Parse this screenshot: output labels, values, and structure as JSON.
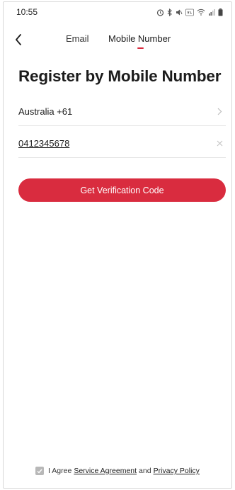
{
  "status_bar": {
    "time": "10:55"
  },
  "nav": {
    "back_icon": "chevron-left-icon",
    "tabs": [
      {
        "label": "Email"
      },
      {
        "label": "Mobile Number"
      }
    ],
    "active_tab": "Mobile Number"
  },
  "main": {
    "title": "Register by Mobile Number",
    "country_label": "Australia +61",
    "phone_value": "0412345678",
    "button_label": "Get Verification Code"
  },
  "footer": {
    "agree_text": "I Agree",
    "service_agreement": "Service Agreement",
    "and_text": "and",
    "privacy_policy": "Privacy Policy",
    "checked": true
  },
  "colors": {
    "accent": "#d92c3f",
    "checkbox": "#b8b8b8",
    "divider": "#e6e6e6"
  }
}
